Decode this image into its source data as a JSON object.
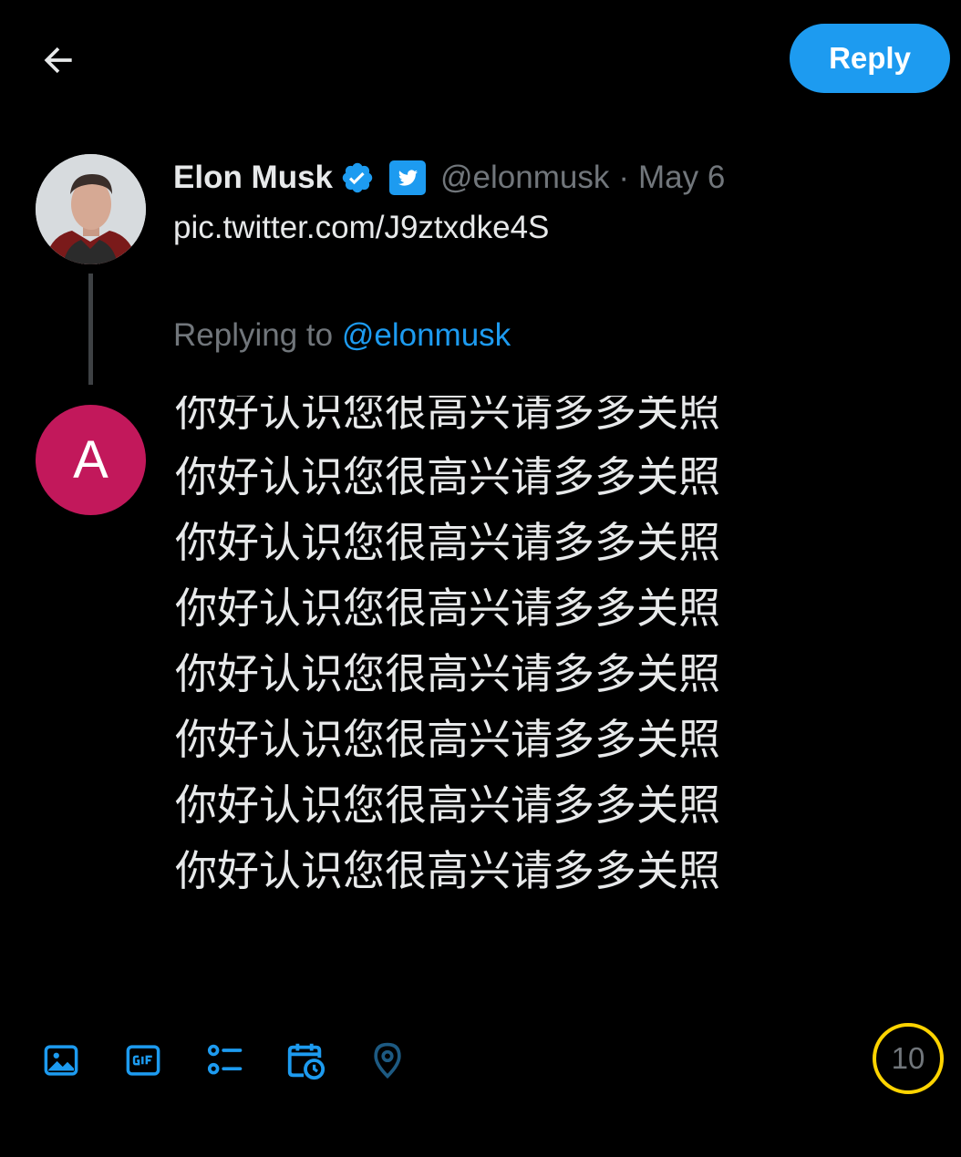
{
  "header": {
    "back_icon": "arrow-left-icon",
    "reply_label": "Reply",
    "accent_color": "#1d9bf0"
  },
  "original_tweet": {
    "author_name": "Elon Musk",
    "verified_icon": "verified-badge-icon",
    "badge_icon": "twitter-bird-badge-icon",
    "handle": "@elonmusk",
    "separator": "·",
    "date": "May 6",
    "text": "pic.twitter.com/J9ztxdke4S"
  },
  "reply": {
    "replying_to_label": "Replying to",
    "replying_to_handle": "@elonmusk",
    "user_avatar_letter": "A",
    "user_avatar_color": "#c2185b",
    "compose_lines": [
      "你好认识您很高兴请多多关照",
      "你好认识您很高兴请多多关照",
      "你好认识您很高兴请多多关照",
      "你好认识您很高兴请多多关照",
      "你好认识您很高兴请多多关照",
      "你好认识您很高兴请多多关照",
      "你好认识您很高兴请多多关照",
      "你好认识您很高兴请多多关照"
    ]
  },
  "toolbar": {
    "icons": [
      "image-icon",
      "gif-icon",
      "poll-icon",
      "schedule-icon",
      "location-icon"
    ],
    "char_remaining": "10",
    "counter_color": "#ffd400"
  }
}
